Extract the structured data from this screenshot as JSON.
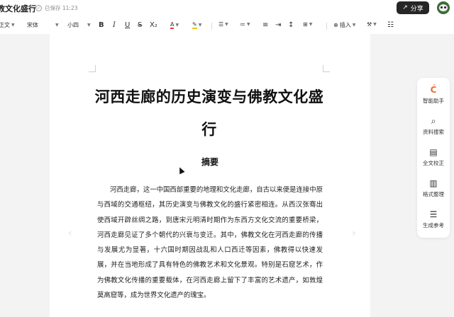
{
  "header": {
    "doc_title": "教文化盛行",
    "save_status": "已保存 11:23",
    "share_label": "分享"
  },
  "toolbar": {
    "style": "正文",
    "font": "宋体",
    "size": "小四",
    "bold": "B",
    "italic": "I",
    "underline": "U",
    "strike": "S",
    "subscript": "X₂",
    "font_color": "A",
    "insert_label": "插入"
  },
  "document": {
    "title": "河西走廊的历史演变与佛教文化盛行",
    "abstract_heading": "摘要",
    "body": "河西走廊，这一中国西部重要的地理和文化走廊，自古以来便是连接中原与西域的交通枢纽，其历史演变与佛教文化的盛行紧密相连。从西汉张骞出使西域开辟丝绸之路，到唐宋元明清时期作为东西方文化交流的重要桥梁，河西走廊见证了多个朝代的兴衰与变迁。其中，佛教文化在河西走廊的传播与发展尤为显著，十六国时期因战乱和人口西迁等因素，佛教得以快速发展，并在当地形成了具有特色的佛教艺术和文化景观。特别是石窟艺术，作为佛教文化传播的重要载体，在河西走廊上留下了丰富的艺术遗产，如敦煌莫高窟等，成为世界文化遗产的瑰宝。"
  },
  "sidepanel": {
    "items": [
      {
        "label": "智能助手",
        "icon": "assistant-icon"
      },
      {
        "label": "资料搜索",
        "icon": "search-icon"
      },
      {
        "label": "全文校正",
        "icon": "proofread-icon"
      },
      {
        "label": "格式整理",
        "icon": "format-icon"
      },
      {
        "label": "生成参考",
        "icon": "reference-icon"
      }
    ]
  },
  "colors": {
    "share_bg": "#262626",
    "font_color_bar": "#e23c3c",
    "highlight_bar": "#f3c614",
    "brand": "#ef6b2f"
  }
}
